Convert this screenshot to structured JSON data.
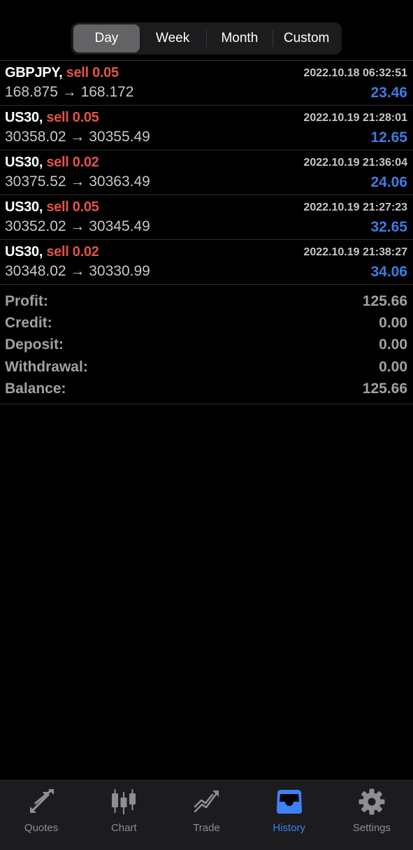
{
  "segments": [
    "Day",
    "Week",
    "Month",
    "Custom"
  ],
  "active_segment": "Day",
  "deals": [
    {
      "symbol": "GBPJPY,",
      "side": "sell 0.05",
      "time": "2022.10.18 06:32:51",
      "prices": "168.875 → 168.172",
      "profit": "23.46"
    },
    {
      "symbol": "US30,",
      "side": "sell 0.05",
      "time": "2022.10.19 21:28:01",
      "prices": "30358.02 → 30355.49",
      "profit": "12.65"
    },
    {
      "symbol": "US30,",
      "side": "sell 0.02",
      "time": "2022.10.19 21:36:04",
      "prices": "30375.52 → 30363.49",
      "profit": "24.06"
    },
    {
      "symbol": "US30,",
      "side": "sell 0.05",
      "time": "2022.10.19 21:27:23",
      "prices": "30352.02 → 30345.49",
      "profit": "32.65"
    },
    {
      "symbol": "US30,",
      "side": "sell 0.02",
      "time": "2022.10.19 21:38:27",
      "prices": "30348.02 → 30330.99",
      "profit": "34.06"
    }
  ],
  "summary": [
    {
      "label": "Profit:",
      "value": "125.66"
    },
    {
      "label": "Credit:",
      "value": "0.00"
    },
    {
      "label": "Deposit:",
      "value": "0.00"
    },
    {
      "label": "Withdrawal:",
      "value": "0.00"
    },
    {
      "label": "Balance:",
      "value": "125.66"
    }
  ],
  "tabs": [
    {
      "label": "Quotes",
      "icon": "quotes-icon"
    },
    {
      "label": "Chart",
      "icon": "candlestick-chart-icon"
    },
    {
      "label": "Trade",
      "icon": "trade-trend-icon"
    },
    {
      "label": "History",
      "icon": "inbox-tray-icon"
    },
    {
      "label": "Settings",
      "icon": "gear-icon"
    }
  ],
  "active_tab": "History",
  "colors": {
    "accent": "#3b82f6",
    "sell": "#e0534a",
    "profit": "#3f7be0",
    "inactive_icon": "#8e8e93"
  }
}
